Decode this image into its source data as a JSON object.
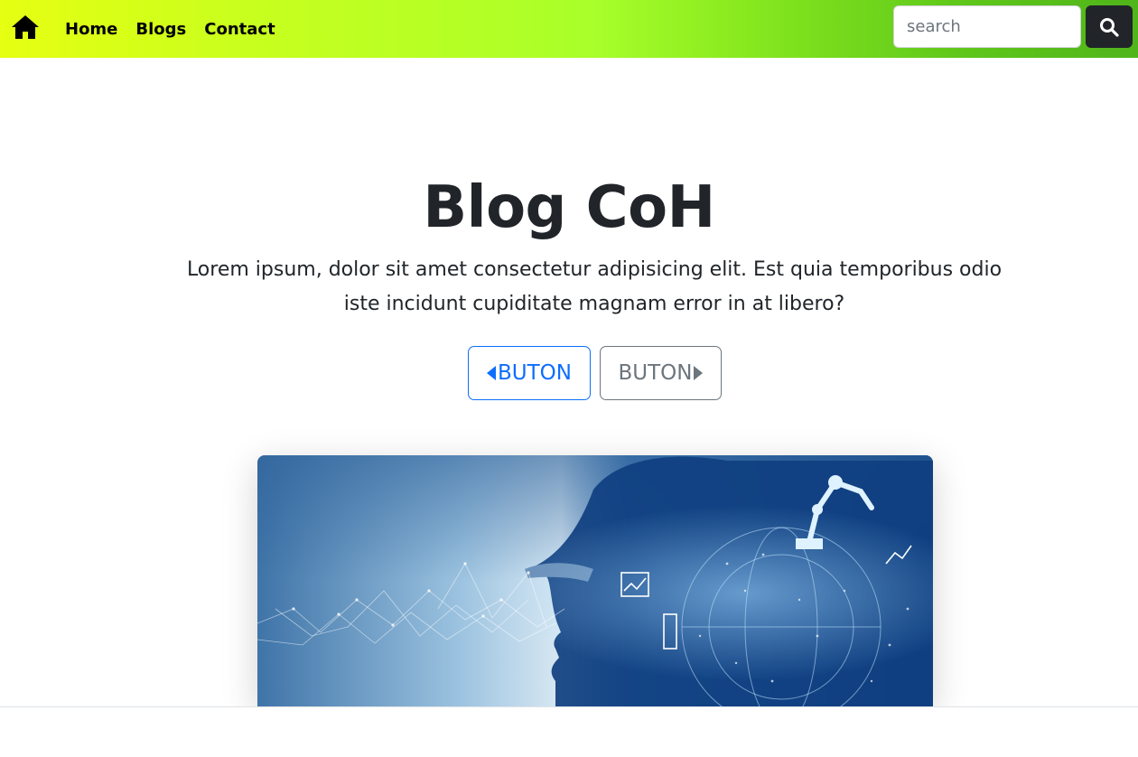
{
  "nav": {
    "home_icon": "home-icon",
    "links": [
      {
        "label": "Home"
      },
      {
        "label": "Blogs"
      },
      {
        "label": "Contact"
      }
    ],
    "search": {
      "placeholder": "search",
      "value": "",
      "button_icon": "search-icon"
    },
    "gradient_colors": [
      "#e6ff12",
      "#a9ff2a",
      "#4fb51a"
    ]
  },
  "hero": {
    "title": "Blog CoH",
    "text": "Lorem ipsum, dolor sit amet consectetur adipisicing elit. Est quia temporibus odio iste incidunt cupiditate magnam error in at libero?",
    "buttons": [
      {
        "label": "BUTON",
        "icon": "caret-left-icon",
        "style": "outline-primary",
        "color": "#0d6efd"
      },
      {
        "label": "BUTON",
        "icon": "caret-right-icon",
        "style": "outline-secondary",
        "color": "#6c757d"
      }
    ]
  },
  "image": {
    "subject": "technology-engineer-illustration"
  }
}
